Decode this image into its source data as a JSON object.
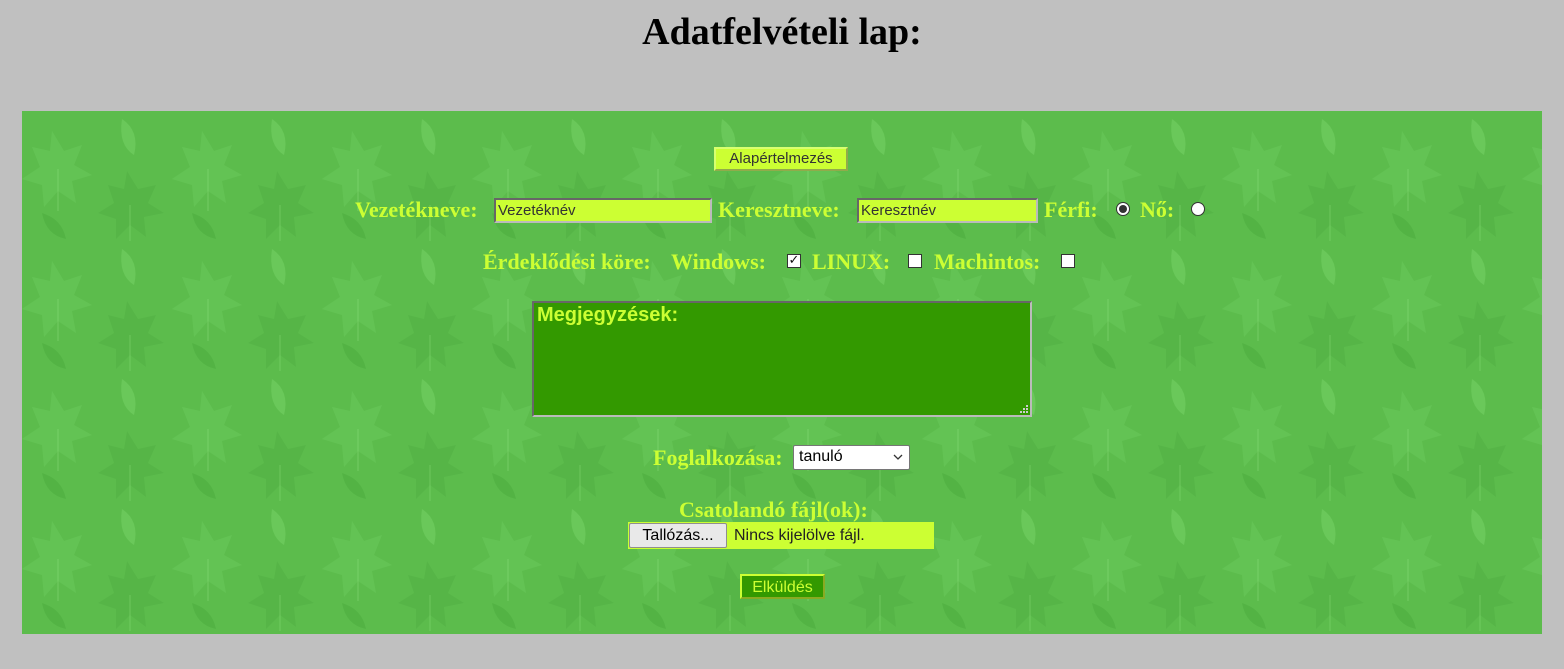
{
  "page": {
    "title": "Adatfelvételi lap:"
  },
  "form": {
    "reset_button": "Alapértelmezés",
    "last_name": {
      "label": "Vezetékneve:",
      "value": "Vezetéknév"
    },
    "first_name": {
      "label": "Keresztneve:",
      "value": "Keresztnév"
    },
    "gender": {
      "male_label": "Férfi:",
      "female_label": "Nő:",
      "selected": "male"
    },
    "interests": {
      "label": "Érdeklődési köre:",
      "options": [
        {
          "label": "Windows:",
          "checked": true
        },
        {
          "label": "LINUX:",
          "checked": false
        },
        {
          "label": "Machintos:",
          "checked": false
        }
      ]
    },
    "notes": {
      "value": "Megjegyzések:"
    },
    "occupation": {
      "label": "Foglalkozása:",
      "selected": "tanuló"
    },
    "attachment": {
      "label": "Csatolandó fájl(ok):",
      "browse_button": "Tallózás...",
      "status": "Nincs kijelölve fájl."
    },
    "submit_button": "Elküldés"
  },
  "colors": {
    "page_background": "#c0c0c0",
    "panel_background": "#5cbc4c",
    "label_text": "#ccff33",
    "input_background": "#ccff33",
    "textarea_background": "#339900",
    "submit_background": "#339900"
  },
  "icons": {
    "background_pattern": "leaf-pattern",
    "select_arrow": "chevron-down-icon",
    "textarea_resize": "resize-grip-icon"
  }
}
